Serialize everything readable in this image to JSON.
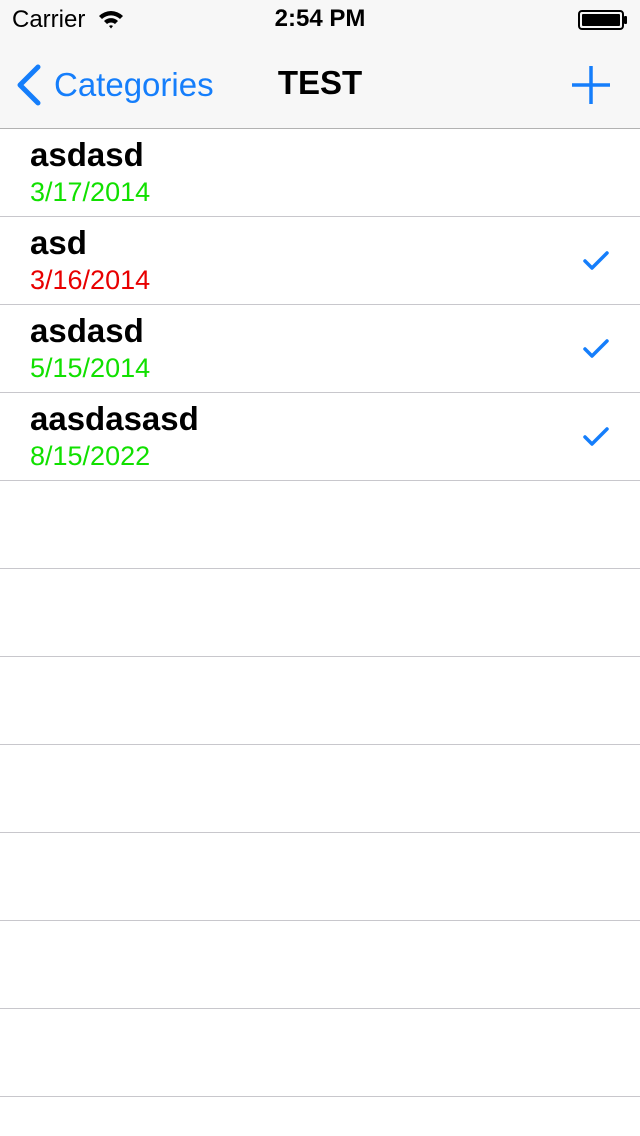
{
  "status_bar": {
    "carrier": "Carrier",
    "time": "2:54 PM"
  },
  "nav": {
    "back_label": "Categories",
    "title": "TEST",
    "add_icon": "plus-icon"
  },
  "colors": {
    "accent": "#157efb",
    "date_ok": "#11e000",
    "date_overdue": "#e80000"
  },
  "items": [
    {
      "title": "asdasd",
      "date": "3/17/2014",
      "status": "ok",
      "checked": false
    },
    {
      "title": "asd",
      "date": "3/16/2014",
      "status": "overdue",
      "checked": true
    },
    {
      "title": "asdasd",
      "date": "5/15/2014",
      "status": "ok",
      "checked": true
    },
    {
      "title": "aasdasasd",
      "date": "8/15/2022",
      "status": "ok",
      "checked": true
    }
  ],
  "empty_rows": 7
}
